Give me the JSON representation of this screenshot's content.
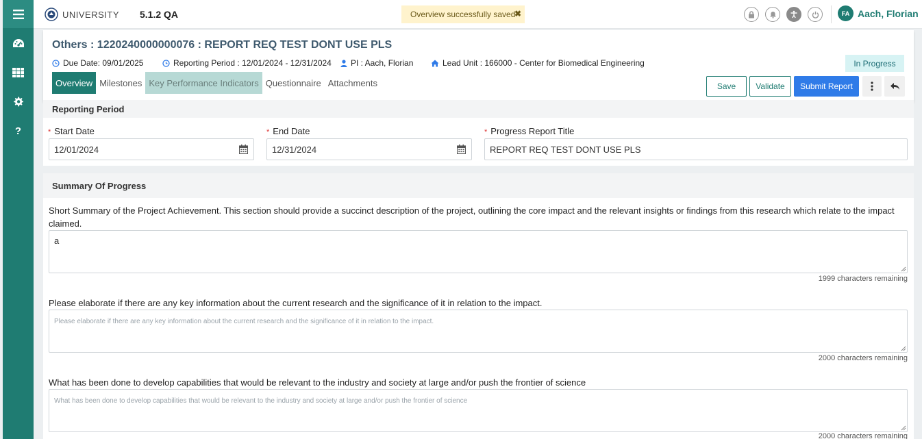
{
  "header": {
    "brand": "UNIVERSITY",
    "version": "5.1.2 QA",
    "toast": "Overview successfully saved",
    "user_initials": "FA",
    "user_name": "Aach, Florian"
  },
  "report": {
    "title": "Others : 1220240000000076 : REPORT REQ TEST DONT USE PLS",
    "due_date": "Due Date: 09/01/2025",
    "reporting_period": "Reporting Period : 12/01/2024 - 12/31/2024",
    "pi": "PI : Aach, Florian",
    "lead_unit": "Lead Unit : 166000 - Center for Biomedical Engineering",
    "status": "In Progress",
    "tabs": [
      "Overview",
      "Milestones",
      "Key Performance Indicators",
      "Questionnaire",
      "Attachments"
    ],
    "actions": {
      "save": "Save",
      "validate": "Validate",
      "submit": "Submit Report"
    }
  },
  "reporting_period_section": {
    "title": "Reporting Period",
    "start_label": "Start Date",
    "start_value": "12/01/2024",
    "end_label": "End Date",
    "end_value": "12/31/2024",
    "title_label": "Progress Report Title",
    "title_value": "REPORT REQ TEST DONT USE PLS"
  },
  "summary_section": {
    "title": "Summary Of Progress",
    "questions": [
      {
        "label": "Short Summary of the Project Achievement. This section should provide a succinct description of the project, outlining the core impact and the relevant insights or findings from this research which relate to the impact claimed.",
        "value": "a",
        "placeholder": "",
        "remaining": "1999 characters remaining"
      },
      {
        "label": "Please elaborate if there are any key information about the current research and the significance of it in relation to the impact.",
        "value": "",
        "placeholder": "Please elaborate if there are any key information about the current research and the significance of it in relation to the impact.",
        "remaining": "2000 characters remaining"
      },
      {
        "label": "What has been done to develop capabilities that would be relevant to the industry and society at large and/or push the frontier of science",
        "value": "",
        "placeholder": "What has been done to develop capabilities that would be relevant to the industry and society at large and/or push the frontier of science",
        "remaining": "2000 characters remaining"
      }
    ]
  },
  "icons": {
    "menu": "hamburger-icon",
    "dashboard": "dashboard-icon",
    "apps": "grid-icon",
    "settings": "gear-icon",
    "help": "question-icon"
  },
  "colors": {
    "brand": "#1f7c72",
    "primary_button": "#2f7be8",
    "title": "#3f5a6e",
    "status_bg": "#d7f3f4",
    "toast_bg": "#fff3cd"
  }
}
